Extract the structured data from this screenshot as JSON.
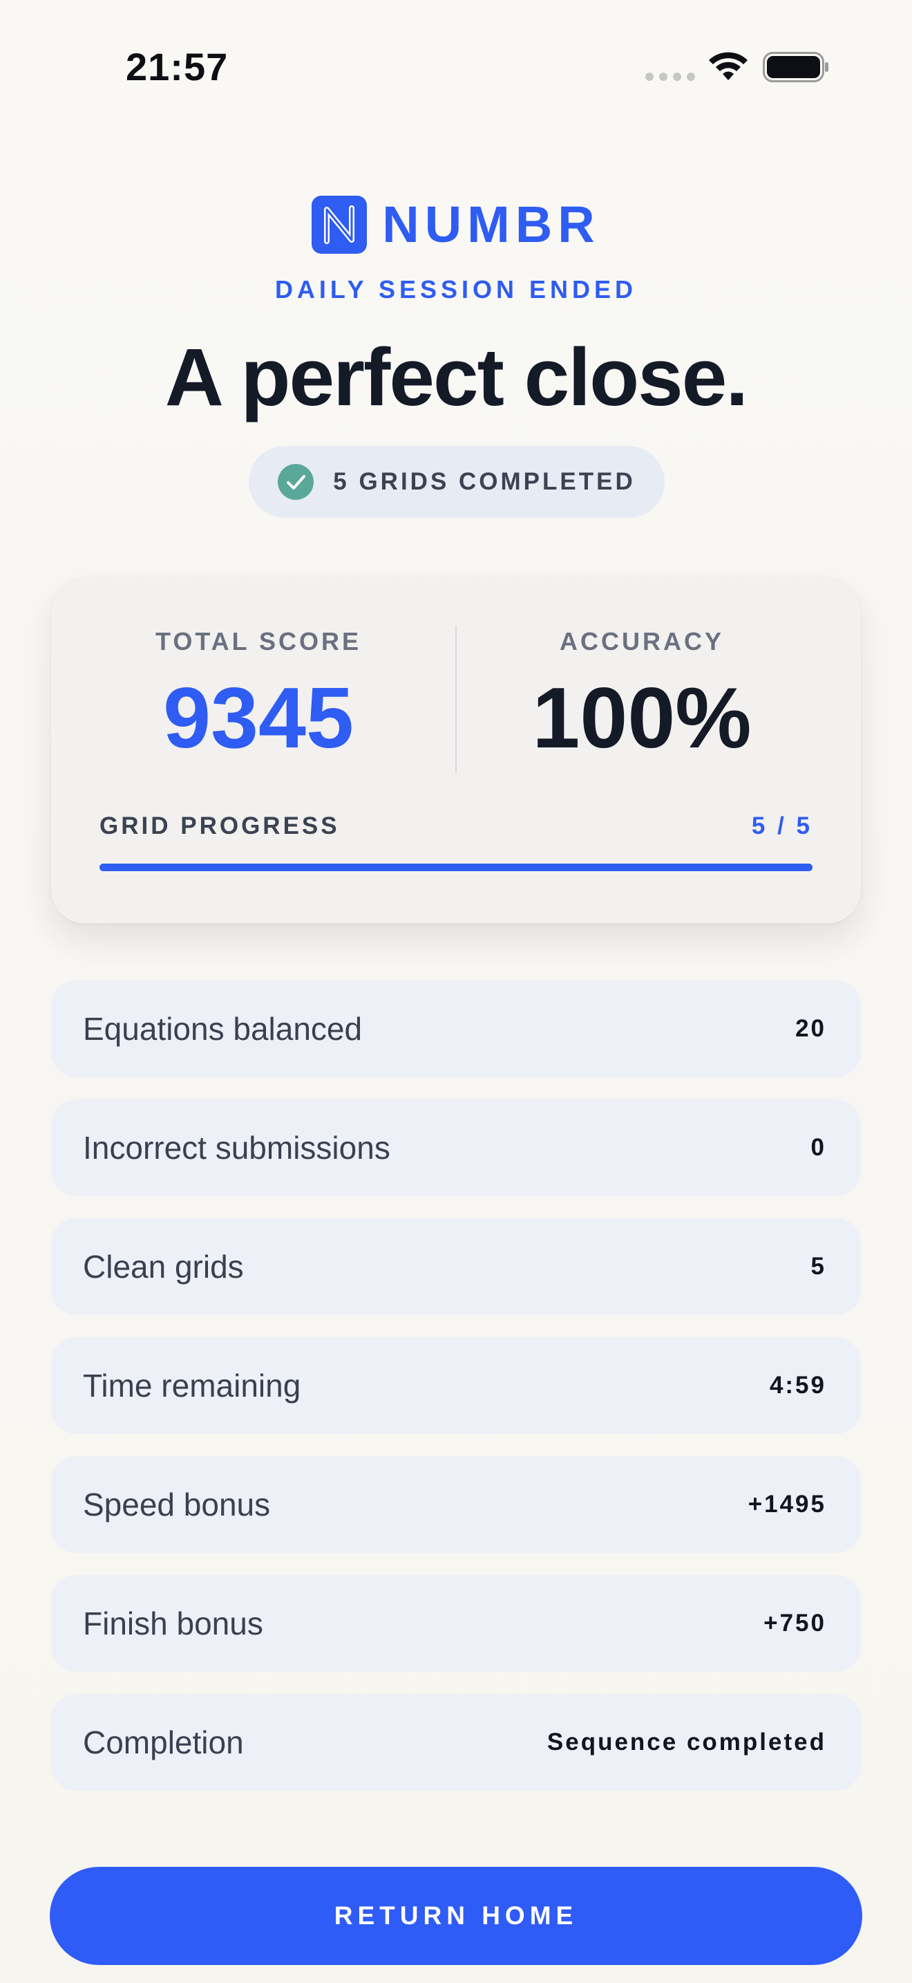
{
  "status_bar": {
    "time": "21:57"
  },
  "brand": {
    "name": "NUMBR",
    "accent_color": "#2f5cf2",
    "logo_icon": "n-logo-icon"
  },
  "header": {
    "subtitle": "DAILY SESSION ENDED",
    "headline": "A perfect close.",
    "badge": {
      "label": "5 GRIDS COMPLETED",
      "icon": "check-circle-icon",
      "icon_color": "#5aa89a"
    }
  },
  "score_card": {
    "total_score_label": "TOTAL SCORE",
    "total_score_value": "9345",
    "accuracy_label": "ACCURACY",
    "accuracy_value": "100%",
    "progress_label": "GRID PROGRESS",
    "progress_text": "5 / 5",
    "progress_fraction": 1.0
  },
  "stats": [
    {
      "label": "Equations balanced",
      "value": "20"
    },
    {
      "label": "Incorrect submissions",
      "value": "0"
    },
    {
      "label": "Clean grids",
      "value": "5"
    },
    {
      "label": "Time remaining",
      "value": "4:59"
    },
    {
      "label": "Speed bonus",
      "value": "+1495"
    },
    {
      "label": "Finish bonus",
      "value": "+750"
    },
    {
      "label": "Completion",
      "value": "Sequence completed"
    }
  ],
  "actions": {
    "return_home_label": "RETURN HOME"
  }
}
